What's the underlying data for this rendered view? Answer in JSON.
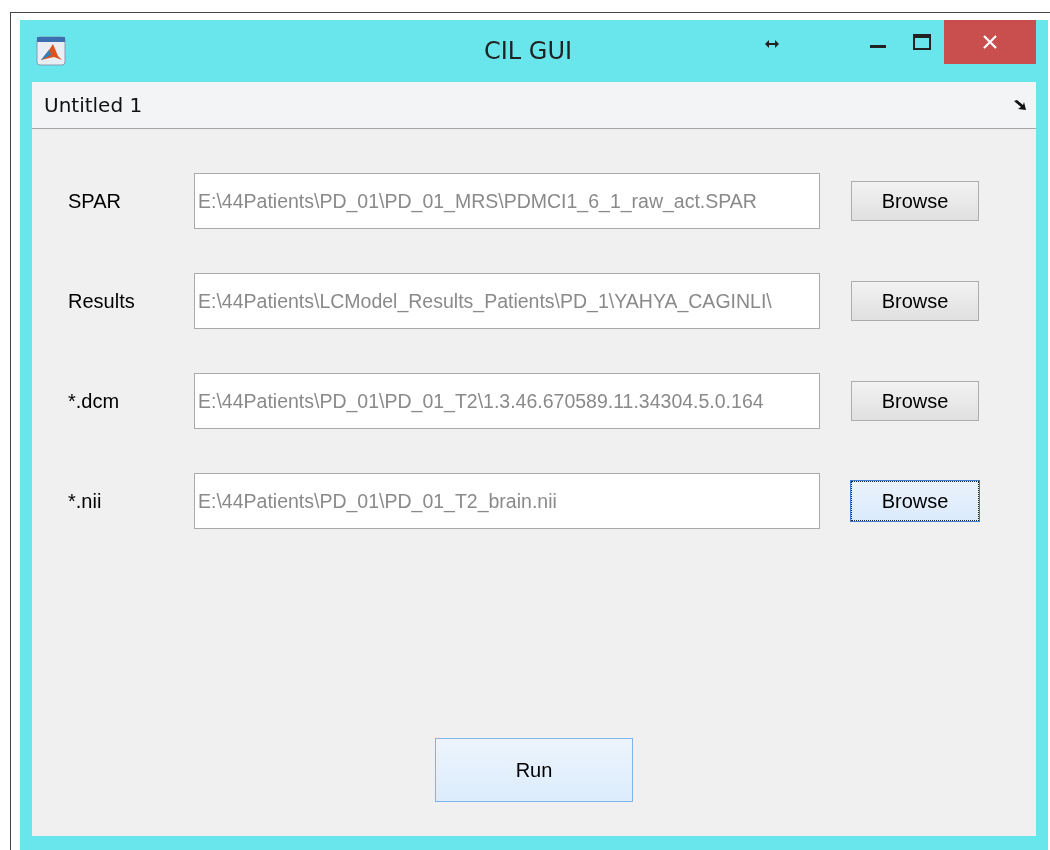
{
  "window": {
    "title": "CIL GUI"
  },
  "menu_bar": {
    "label": "Untitled 1"
  },
  "rows": [
    {
      "label": "SPAR",
      "path": "E:\\44Patients\\PD_01\\PD_01_MRS\\PDMCI1_6_1_raw_act.SPAR",
      "button": "Browse",
      "focused": false
    },
    {
      "label": "Results",
      "path": "E:\\44Patients\\LCModel_Results_Patients\\PD_1\\YAHYA_CAGINLI\\",
      "button": "Browse",
      "focused": false
    },
    {
      "label": "*.dcm",
      "path": "E:\\44Patients\\PD_01\\PD_01_T2\\1.3.46.670589.11.34304.5.0.164",
      "button": "Browse",
      "focused": false
    },
    {
      "label": "*.nii",
      "path": "E:\\44Patients\\PD_01\\PD_01_T2_brain.nii",
      "button": "Browse",
      "focused": true
    }
  ],
  "run_button": {
    "label": "Run",
    "default": true
  }
}
